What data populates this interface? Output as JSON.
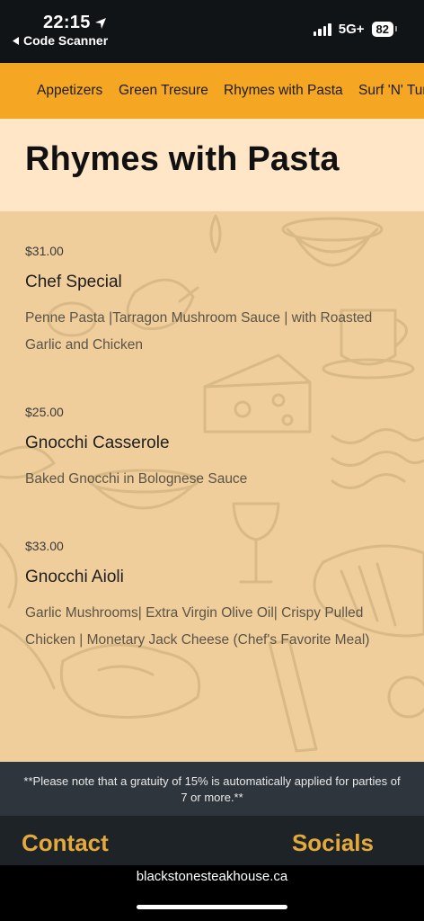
{
  "status_bar": {
    "time": "22:15",
    "back_label": "Code Scanner",
    "network": "5G+",
    "battery": "82"
  },
  "nav": {
    "categories": [
      "Appetizers",
      "Green Tresure",
      "Rhymes with Pasta",
      "Surf 'N' Turf"
    ]
  },
  "section": {
    "title": "Rhymes with Pasta"
  },
  "menu_items": [
    {
      "price": "$31.00",
      "name": "Chef Special",
      "description": "Penne Pasta |Tarragon Mushroom Sauce | with Roasted Garlic and Chicken"
    },
    {
      "price": "$25.00",
      "name": "Gnocchi Casserole",
      "description": "Baked Gnocchi in Bolognese Sauce"
    },
    {
      "price": "$33.00",
      "name": "Gnocchi Aioli",
      "description": "Garlic Mushrooms| Extra Virgin Olive Oil| Crispy Pulled Chicken | Monetary Jack Cheese (Chef's Favorite Meal)"
    }
  ],
  "note": {
    "text": "**Please note that a gratuity of 15% is automatically applied for parties of 7 or more.**"
  },
  "footer": {
    "contact_label": "Contact",
    "socials_label": "Socials"
  },
  "browser": {
    "url": "blackstonesteakhouse.ca"
  },
  "colors": {
    "nav_bg": "#F5A623",
    "heading_bg": "#FFE6C7",
    "menu_bg": "#EFCE9C",
    "note_bg": "#2F353D",
    "footer_bg": "#1E2328",
    "footer_accent": "#E3A93B"
  }
}
